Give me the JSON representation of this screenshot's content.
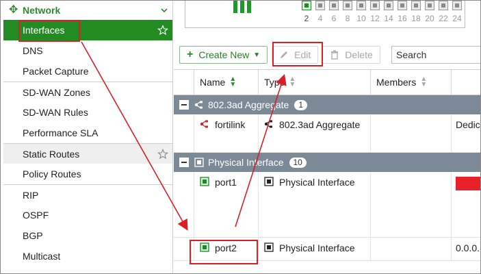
{
  "sidebar": {
    "section": "Network",
    "items": [
      {
        "label": "Interfaces",
        "active": true,
        "star": true
      },
      {
        "label": "DNS"
      },
      {
        "label": "Packet Capture"
      },
      {
        "label": "SD-WAN Zones",
        "sep": true
      },
      {
        "label": "SD-WAN Rules"
      },
      {
        "label": "Performance SLA"
      },
      {
        "label": "Static Routes",
        "sep": true,
        "highlight": true,
        "star": true
      },
      {
        "label": "Policy Routes"
      },
      {
        "label": "RIP",
        "sep": true
      },
      {
        "label": "OSPF"
      },
      {
        "label": "BGP"
      },
      {
        "label": "Multicast"
      }
    ]
  },
  "ports": {
    "labels": [
      "2",
      "4",
      "6",
      "8",
      "10",
      "12",
      "14",
      "16",
      "18",
      "20",
      "22",
      "24"
    ]
  },
  "toolbar": {
    "create_label": "Create New",
    "edit_label": "Edit",
    "delete_label": "Delete",
    "search_placeholder": "Search"
  },
  "table": {
    "headers": [
      "Name",
      "Type",
      "Members"
    ],
    "groups": [
      {
        "label": "802.3ad Aggregate",
        "count": "1",
        "rows": [
          {
            "name": "fortilink",
            "type": "802.3ad Aggregate",
            "extra": "Dedic"
          }
        ]
      },
      {
        "label": "Physical Interface",
        "count": "10",
        "rows": [
          {
            "name": "port1",
            "type": "Physical Interface",
            "extra": ""
          },
          {
            "name": "port2",
            "type": "Physical Interface",
            "extra": "0.0.0."
          }
        ]
      }
    ]
  },
  "colors": {
    "accent": "#228b22",
    "group_bar": "#7b8a96",
    "annotation": "#d81f26"
  }
}
